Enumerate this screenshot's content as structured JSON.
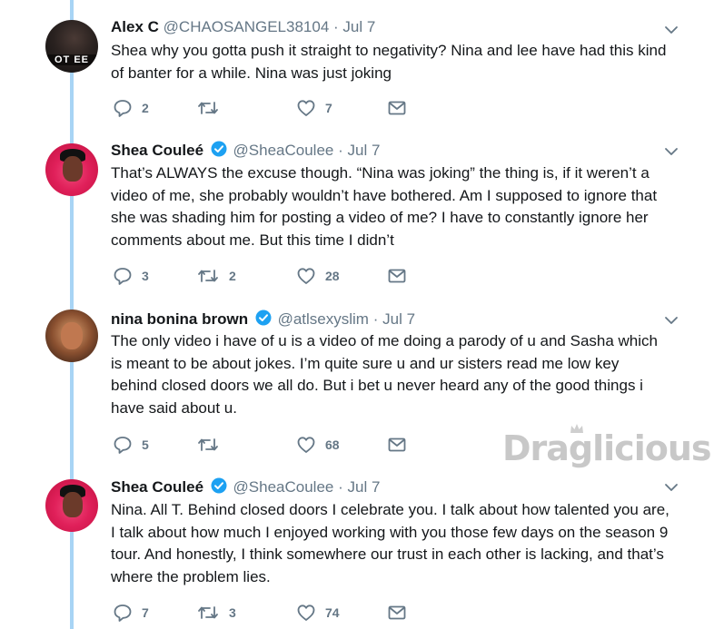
{
  "tweets": [
    {
      "name": "Alex C",
      "verified": false,
      "handle": "@CHAOSANGEL38104",
      "separator": "·",
      "date": "Jul 7",
      "avatar_overlay": "OT EE",
      "text": "Shea why you gotta push it straight to negativity? Nina and lee have had this kind of banter for a while. Nina was just joking",
      "replies": "2",
      "retweets": "",
      "likes": "7"
    },
    {
      "name": "Shea Couleé",
      "verified": true,
      "handle": "@SheaCoulee",
      "separator": "·",
      "date": "Jul 7",
      "text": "That’s ALWAYS the excuse though. “Nina was joking” the thing is, if it weren’t a video of me, she probably wouldn’t have bothered. Am I supposed to ignore that she was shading him for posting a video of me? I have to constantly ignore her comments about me. But this time I didn’t",
      "replies": "3",
      "retweets": "2",
      "likes": "28"
    },
    {
      "name": "nina bonina brown",
      "verified": true,
      "handle": "@atlsexyslim",
      "separator": "·",
      "date": "Jul 7",
      "text": "The only video i have of u is a video of me doing a parody of u and Sasha which is meant to be about jokes. I’m quite sure u and ur sisters read me low key behind closed doors we all do. But i bet u never heard any of the good things i have said about u.",
      "replies": "5",
      "retweets": "",
      "likes": "68"
    },
    {
      "name": "Shea Couleé",
      "verified": true,
      "handle": "@SheaCoulee",
      "separator": "·",
      "date": "Jul 7",
      "text": "Nina. All T. Behind closed doors I celebrate you. I talk about how talented you are, I talk about how much I enjoyed working with you those few days on the season 9 tour. And honestly, I think somewhere our trust in each other is lacking, and that’s where the problem lies.",
      "replies": "7",
      "retweets": "3",
      "likes": "74"
    }
  ],
  "watermark": "Draglicious",
  "colors": {
    "thread_line": "#a8d4f5",
    "icon_gray": "#657786",
    "verified_blue": "#1da1f2",
    "text": "#14171a"
  }
}
